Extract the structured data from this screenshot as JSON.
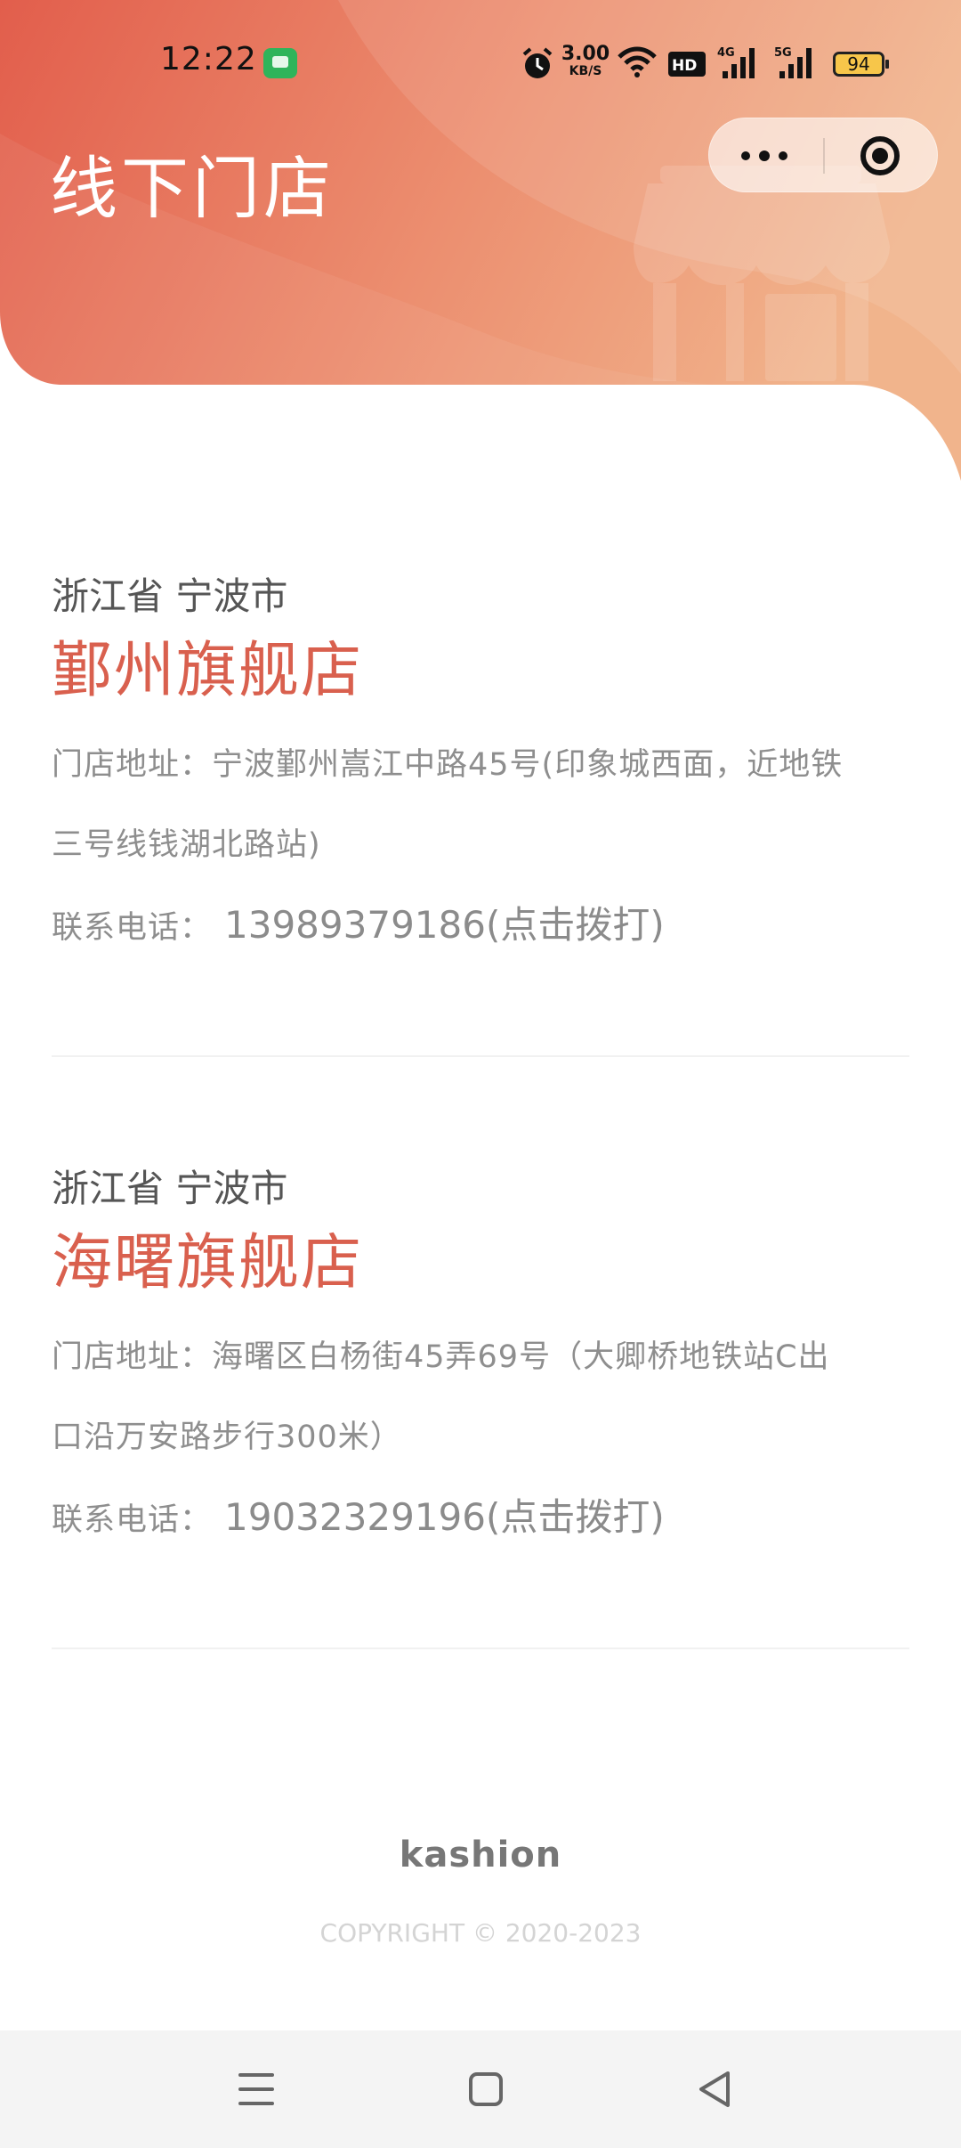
{
  "status_bar": {
    "time": "12:22",
    "speed_value": "3.00",
    "speed_unit": "KB/S",
    "battery": "94",
    "icons": [
      "message-icon",
      "alarm-icon",
      "wifi-icon",
      "hd-icon",
      "signal-4g-icon",
      "signal-5g-icon",
      "battery-icon"
    ]
  },
  "header": {
    "title": "线下门店",
    "capsule": {
      "more_icon": "more-dots-icon",
      "close_icon": "target-close-icon"
    },
    "decoration_icon": "storefront-icon",
    "colors": {
      "gradient_start": "#e4614f",
      "gradient_end": "#f0b08a"
    }
  },
  "stores": [
    {
      "region": "浙江省 宁波市",
      "name": "鄞州旗舰店",
      "address_line1": "门店地址：宁波鄞州嵩江中路45号(印象城西面，近地铁",
      "address_line2": "三号线钱湖北路站)",
      "phone_label": "联系电话：",
      "phone": "13989379186(点击拨打)"
    },
    {
      "region": "浙江省 宁波市",
      "name": "海曙旗舰店",
      "address_line1": "门店地址：海曙区白杨街45弄69号（大卿桥地铁站C出",
      "address_line2": "口沿万安路步行300米）",
      "phone_label": "联系电话：",
      "phone": "19032329196(点击拨打)"
    }
  ],
  "footer": {
    "brand": "kashion",
    "copyright": "COPYRIGHT © 2020-2023"
  },
  "navbar": {
    "icons": [
      "menu-icon",
      "home-square-icon",
      "back-triangle-icon"
    ]
  },
  "accent_color": "#d9604e"
}
